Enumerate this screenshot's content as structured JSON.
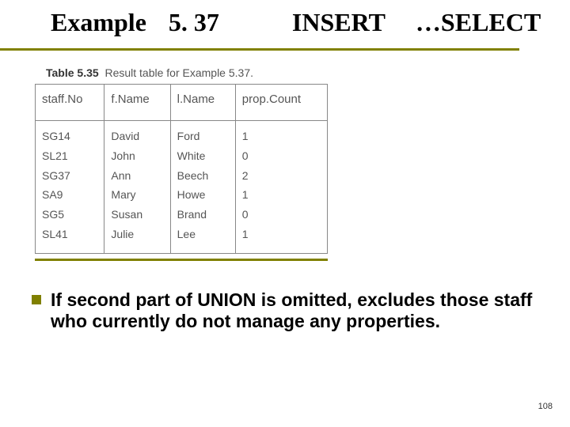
{
  "title": {
    "word1": "Example",
    "word2": "5. 37",
    "word3": "INSERT",
    "word4": "…",
    "line2": "SELECT"
  },
  "caption": {
    "bold": "Table 5.35",
    "rest": "Result table for Example 5.37."
  },
  "table": {
    "headers": [
      "staff.No",
      "f.Name",
      "l.Name",
      "prop.Count"
    ],
    "rows": [
      [
        "SG14",
        "David",
        "Ford",
        "1"
      ],
      [
        "SL21",
        "John",
        "White",
        "0"
      ],
      [
        "SG37",
        "Ann",
        "Beech",
        "2"
      ],
      [
        "SA9",
        "Mary",
        "Howe",
        "1"
      ],
      [
        "SG5",
        "Susan",
        "Brand",
        "0"
      ],
      [
        "SL41",
        "Julie",
        "Lee",
        "1"
      ]
    ]
  },
  "body": "If second part of UNION is omitted, excludes those staff who currently do not manage any properties.",
  "page": "108"
}
